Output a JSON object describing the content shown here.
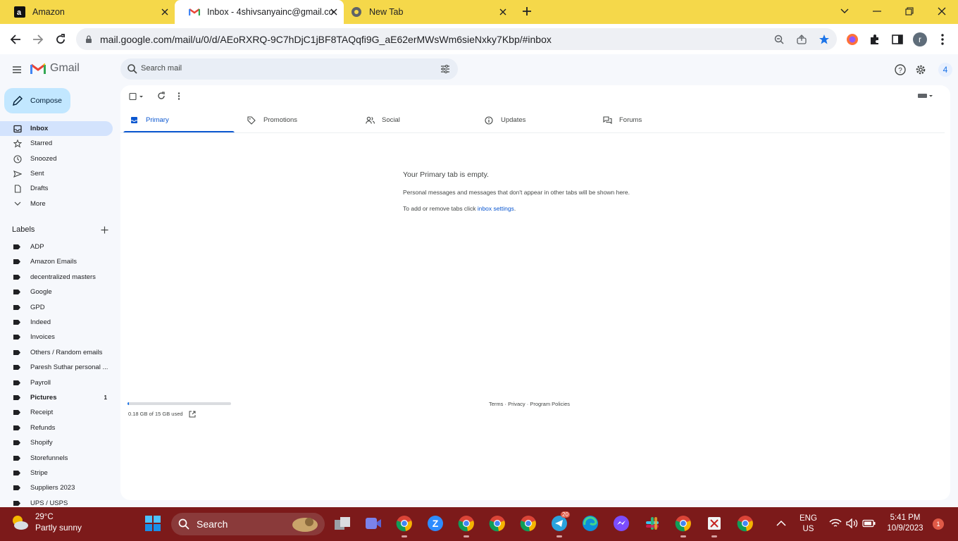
{
  "browser": {
    "tabs": [
      {
        "title": "Amazon",
        "icon": "amazon-icon"
      },
      {
        "title": "Inbox - 4shivsanyainc@gmail.co",
        "icon": "gmail-icon"
      },
      {
        "title": "New Tab",
        "icon": "chrome-icon"
      }
    ],
    "url": "mail.google.com/mail/u/0/d/AEoRXRQ-9C7hDjC1jBF8TAQqfi9G_aE62erMWsWm6sieNxky7Kbp/#inbox",
    "profile_initial": "r"
  },
  "gmail": {
    "app_name": "Gmail",
    "search_placeholder": "Search mail",
    "account_initial": "4",
    "compose_label": "Compose",
    "nav": [
      {
        "label": "Inbox",
        "icon": "inbox-icon",
        "active": true
      },
      {
        "label": "Starred",
        "icon": "star-icon"
      },
      {
        "label": "Snoozed",
        "icon": "clock-icon"
      },
      {
        "label": "Sent",
        "icon": "send-icon"
      },
      {
        "label": "Drafts",
        "icon": "draft-icon"
      },
      {
        "label": "More",
        "icon": "chevron-down-icon"
      }
    ],
    "labels_heading": "Labels",
    "labels": [
      {
        "name": "ADP"
      },
      {
        "name": "Amazon Emails"
      },
      {
        "name": "decentralized masters"
      },
      {
        "name": "Google"
      },
      {
        "name": "GPD"
      },
      {
        "name": "Indeed"
      },
      {
        "name": "Invoices"
      },
      {
        "name": "Others / Random emails"
      },
      {
        "name": "Paresh Suthar personal ..."
      },
      {
        "name": "Payroll"
      },
      {
        "name": "Pictures",
        "count": "1",
        "bold": true
      },
      {
        "name": "Receipt"
      },
      {
        "name": "Refunds"
      },
      {
        "name": "Shopify"
      },
      {
        "name": "Storefunnels"
      },
      {
        "name": "Stripe"
      },
      {
        "name": "Suppliers 2023"
      },
      {
        "name": "UPS / USPS"
      }
    ],
    "category_tabs": [
      {
        "label": "Primary",
        "icon": "inbox-icon",
        "active": true
      },
      {
        "label": "Promotions",
        "icon": "tag-icon"
      },
      {
        "label": "Social",
        "icon": "people-icon"
      },
      {
        "label": "Updates",
        "icon": "info-icon"
      },
      {
        "label": "Forums",
        "icon": "forum-icon"
      }
    ],
    "empty_state": {
      "title": "Your Primary tab is empty.",
      "description": "Personal messages and messages that don't appear in other tabs will be shown here.",
      "tabs_prefix": "To add or remove tabs click ",
      "tabs_link": "inbox settings",
      "tabs_suffix": "."
    },
    "storage": {
      "text": "0.18 GB of 15 GB used",
      "fraction": 0.012
    },
    "footer": "Terms · Privacy · Program Policies"
  },
  "taskbar": {
    "weather_temp": "29°C",
    "weather_desc": "Partly sunny",
    "search_label": "Search",
    "badges": {
      "telegram": "20"
    },
    "lang_line1": "ENG",
    "lang_line2": "US",
    "time": "5:41 PM",
    "date": "10/9/2023",
    "notifications": "1"
  },
  "colors": {
    "tabstrip": "#f5d84a",
    "taskbar": "#7c1a1a",
    "compose": "#c2e7ff",
    "active_nav": "#d3e3fd",
    "accent": "#0b57d0"
  }
}
